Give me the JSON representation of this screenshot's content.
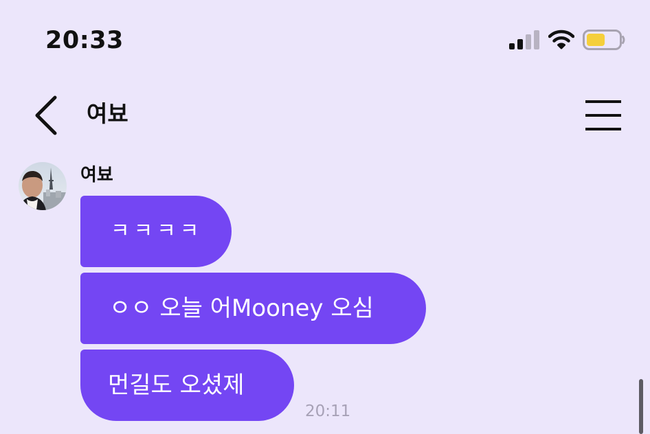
{
  "status_bar": {
    "time": "20:33",
    "icons": [
      "signal-icon",
      "wifi-icon",
      "battery-icon"
    ],
    "battery_color": "#F5CF3B"
  },
  "header": {
    "title": "여뵤",
    "back_icon": "chevron-left-icon",
    "menu_icon": "hamburger-menu-icon"
  },
  "conversation": {
    "sender": {
      "name": "여뵤",
      "avatar_icon": "profile-photo"
    },
    "messages": [
      {
        "text": "ㅋㅋㅋㅋ"
      },
      {
        "text": "ㅇㅇ 오늘 어Mooney 오심"
      },
      {
        "text": "먼길도 오셨제"
      }
    ],
    "last_timestamp": "20:11"
  },
  "colors": {
    "background": "#ECE6FB",
    "bubble": "#7446F3",
    "bubble_text": "#FFFFFF",
    "timestamp": "#A7A1B6"
  }
}
